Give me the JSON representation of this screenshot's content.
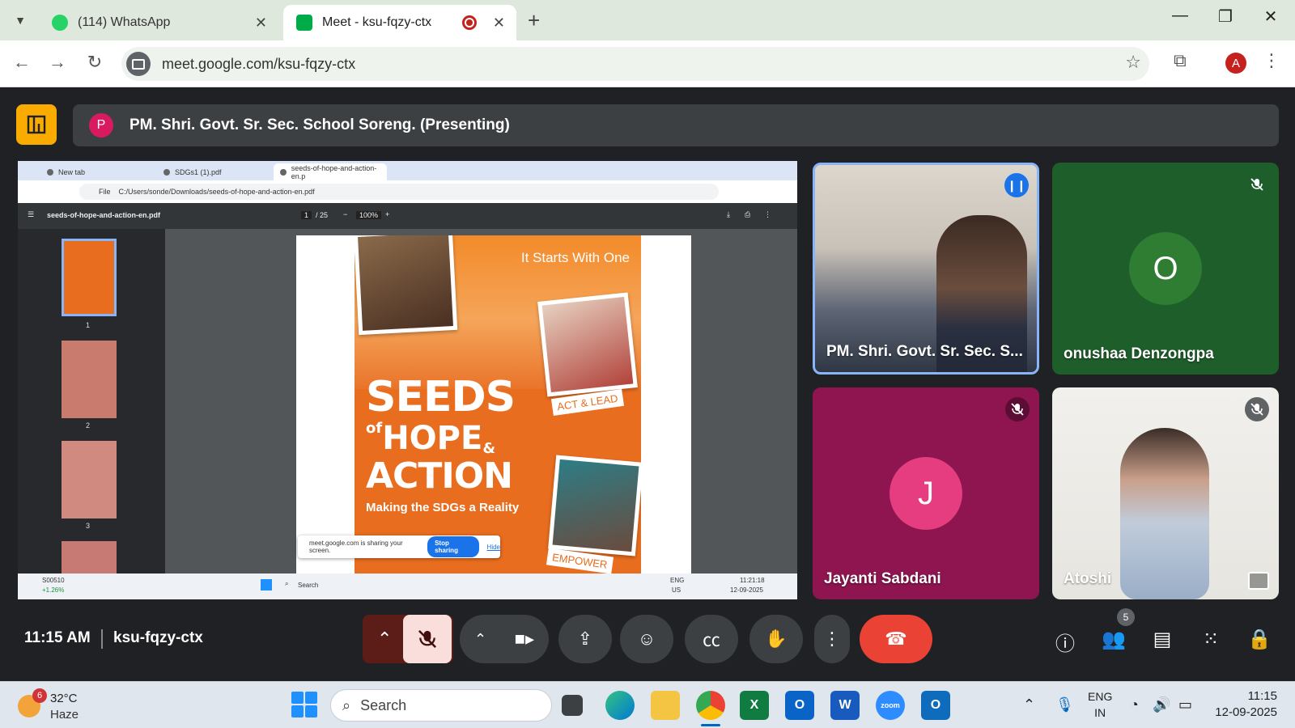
{
  "browser": {
    "tabs": [
      {
        "title": "(114) WhatsApp",
        "favicon_color": "#25d366",
        "active": false
      },
      {
        "title": "Meet - ksu-fqzy-ctx",
        "favicon_color": "#00ac47",
        "active": true
      }
    ],
    "url": "meet.google.com/ksu-fqzy-ctx",
    "profile_initial": "A"
  },
  "meet": {
    "presenter_initial": "P",
    "presenting_text": "PM. Shri. Govt. Sr. Sec. School Soreng. (Presenting)",
    "time": "11:15 AM",
    "meeting_code": "ksu-fqzy-ctx",
    "people_count": "5",
    "participants": [
      {
        "name": "PM. Shri. Govt. Sr. Sec. S...",
        "type": "video",
        "speaking": true
      },
      {
        "name": "onushaa Denzongpa",
        "initial": "O",
        "type": "avatar",
        "bg": "#1e5e2a",
        "avatar_bg": "#2e7d32",
        "muted": true
      },
      {
        "name": "Jayanti Sabdani",
        "initial": "J",
        "type": "avatar",
        "bg": "#8e1550",
        "avatar_bg": "#e53d7f",
        "muted": true
      },
      {
        "name": "Atoshi",
        "type": "video",
        "muted": true
      }
    ]
  },
  "shared_screen": {
    "tabs": [
      "New tab",
      "SDGs1 (1).pdf",
      "seeds-of-hope-and-action-en.p"
    ],
    "address": "C:/Users/sonde/Downloads/seeds-of-hope-and-action-en.pdf",
    "address_scheme": "File",
    "pdf_filename": "seeds-of-hope-and-action-en.pdf",
    "page_current": "1",
    "page_total": "/ 25",
    "zoom": "100%",
    "thumb_numbers": [
      "1",
      "2",
      "3"
    ],
    "cover": {
      "starts": "It Starts With One",
      "seeds": "SEEDS",
      "of": "of",
      "hope": "HOPE",
      "amp": "&",
      "action": "ACTION",
      "subtitle": "Making the SDGs a Reality",
      "tag1": "ACT & LEAD",
      "tag2": "EMPOWER"
    },
    "share_notice": "meet.google.com is sharing your screen.",
    "stop_sharing": "Stop sharing",
    "hide": "Hide",
    "taskbar": {
      "stock": "S00510",
      "stock_change": "+1.26%",
      "search": "Search",
      "lang": "ENG",
      "region": "US",
      "time": "11:21:18",
      "date": "12-09-2025"
    }
  },
  "taskbar": {
    "weather_badge": "6",
    "temperature": "32°C",
    "condition": "Haze",
    "search_placeholder": "Search",
    "lang": "ENG",
    "region": "IN",
    "time": "11:15",
    "date": "12-09-2025"
  }
}
